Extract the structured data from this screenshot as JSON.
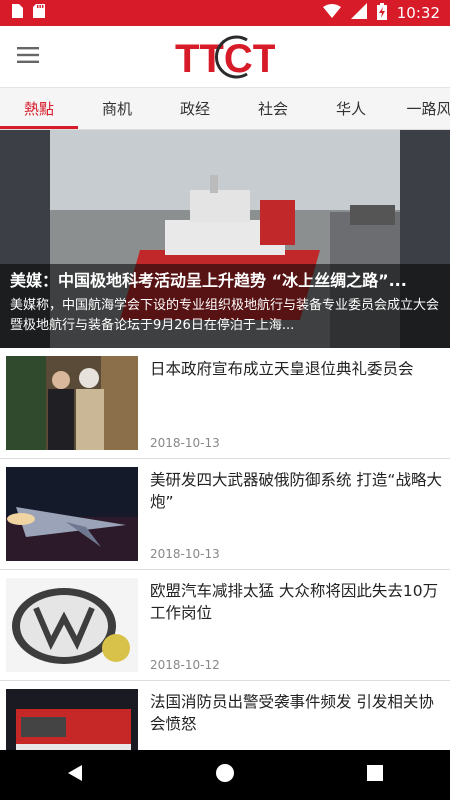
{
  "status_bar": {
    "time": "10:32"
  },
  "app_bar": {
    "logo_text": "TTCT"
  },
  "tabs": [
    {
      "label": "熱點",
      "active": true
    },
    {
      "label": "商机",
      "active": false
    },
    {
      "label": "政经",
      "active": false
    },
    {
      "label": "社会",
      "active": false
    },
    {
      "label": "华人",
      "active": false
    },
    {
      "label": "一路风",
      "active": false
    }
  ],
  "hero": {
    "title": "美媒：中国极地科考活动呈上升趋势 “冰上丝绸之路”...",
    "summary": "美媒称，中国航海学会下设的专业组织极地航行与装备专业委员会成立大会暨极地航行与装备论坛于9月26日在停泊于上海..."
  },
  "news": [
    {
      "title": "日本政府宣布成立天皇退位典礼委员会",
      "date": "2018-10-13",
      "thumb": "imperial-couple-photo"
    },
    {
      "title": "美研发四大武器破俄防御系统 打造“战略大炮”",
      "date": "2018-10-13",
      "thumb": "hypersonic-missile-photo"
    },
    {
      "title": "欧盟汽车减排太猛 大众称将因此失去10万工作岗位",
      "date": "2018-10-12",
      "thumb": "vw-logo-cartoon"
    },
    {
      "title": "法国消防员出警受袭事件频发 引发相关协会愤怒",
      "date": "",
      "thumb": "fire-truck-photo"
    }
  ],
  "colors": {
    "brand_red": "#d81b29",
    "overlay": "rgba(0,0,0,0.55)"
  },
  "icons": {
    "status_left": [
      "sim-card-icon",
      "sd-card-icon"
    ],
    "status_right": [
      "wifi-icon",
      "signal-icon",
      "battery-charging-icon"
    ],
    "app_bar": [
      "hamburger-menu-icon"
    ],
    "nav": [
      "back-icon",
      "home-icon",
      "recents-icon"
    ]
  }
}
